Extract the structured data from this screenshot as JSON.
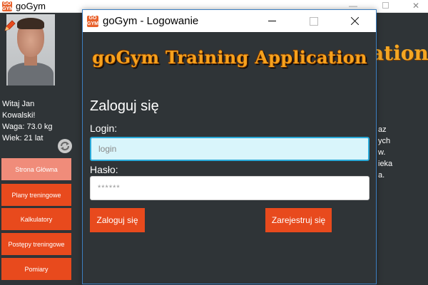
{
  "main_window": {
    "title": "goGym",
    "app_icon_text": "GO GYM"
  },
  "sidebar": {
    "greeting": "Witaj Jan",
    "name": "Kowalski!",
    "weight": "Waga: 73.0 kg",
    "age": "Wiek: 21 lat",
    "nav": [
      {
        "label": "Strona Główna",
        "active": true
      },
      {
        "label": "Plany treningowe",
        "active": false
      },
      {
        "label": "Kalkulatory",
        "active": false
      },
      {
        "label": "Postępy treningowe",
        "active": false
      },
      {
        "label": "Pomiary",
        "active": false
      }
    ]
  },
  "background_content": {
    "heading_fragment": "ation",
    "text_lines": [
      "az",
      "ych",
      "w.",
      "ieka",
      "a."
    ]
  },
  "dialog": {
    "title": "goGym - Logowanie",
    "heading": "goGym Training Application",
    "form_title": "Zaloguj się",
    "login_label": "Login:",
    "login_placeholder": "login",
    "password_label": "Hasło:",
    "password_placeholder": "******",
    "login_button": "Zaloguj się",
    "register_button": "Zarejestruj się"
  },
  "colors": {
    "accent": "#e84a1d",
    "accent_active": "#f08c7a",
    "background": "#2f3437",
    "heading": "#f6a21d",
    "focus_border": "#29a9d8"
  },
  "icons": {
    "edit": "pencil-icon",
    "refresh": "refresh-icon"
  }
}
